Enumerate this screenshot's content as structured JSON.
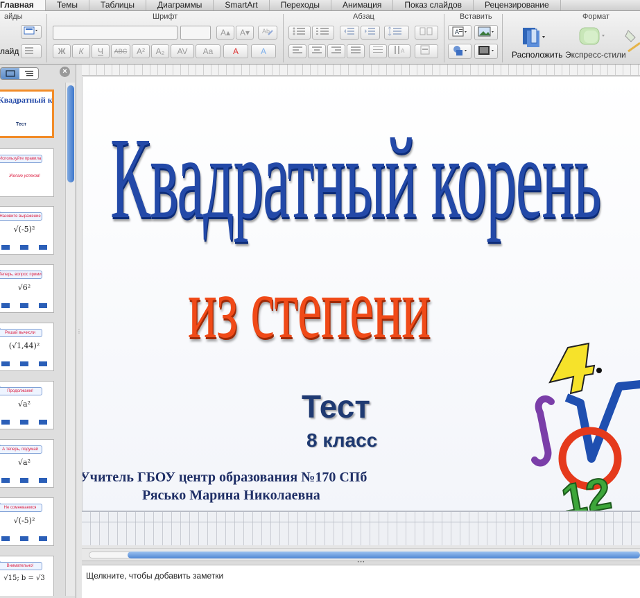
{
  "tabs": [
    "Главная",
    "Темы",
    "Таблицы",
    "Диаграммы",
    "SmartArt",
    "Переходы",
    "Анимация",
    "Показ слайдов",
    "Рецензирование"
  ],
  "ribbon": {
    "groups": {
      "slides": "айды",
      "font": "Шрифт",
      "paragraph": "Абзац",
      "insert": "Вставить",
      "format": "Формат"
    },
    "new_slide_label": "лайд",
    "arrange_label": "Расположить",
    "quick_styles_label": "Экспресс-стили",
    "font_buttons": [
      "Ж",
      "К",
      "Ч",
      "ABC",
      "A²",
      "A₂",
      "AV",
      "Aa",
      "A",
      "A"
    ],
    "size_buttons": [
      "A▴",
      "A▾"
    ]
  },
  "slide": {
    "title_line1": "Квадратный корень",
    "title_line2": "из степени",
    "subtitle": "Тест",
    "grade": "8 класс",
    "teacher_line1": "Учитель ГБОУ центр образования №170  СПб",
    "teacher_line2": "Рясько Марина Николаевна",
    "deco_digits": [
      "4",
      "12"
    ]
  },
  "thumbnails": [
    {
      "title": "Квадратный корень из степени",
      "body": "Тест"
    },
    {
      "title": "Используйте правила",
      "body": "Желаю успехов!"
    },
    {
      "title": "Назовите выражение",
      "body": "√(-5)²"
    },
    {
      "title": "Теперь, вопрос прими",
      "body": "√6²"
    },
    {
      "title": "Решай вычисли",
      "body": "(√1,44)²"
    },
    {
      "title": "Продолжаем!",
      "body": "√a²"
    },
    {
      "title": "А теперь, подумай",
      "body": "√a²"
    },
    {
      "title": "Не сомневаемся",
      "body": "√(-5)²"
    },
    {
      "title": "Внимательно!",
      "body": "√15; b = √3"
    }
  ],
  "notes_placeholder": "Щелкните, чтобы добавить заметки",
  "colors": {
    "title_blue": "#2349a8",
    "title_orange": "#f04a18",
    "text_navy": "#1f3a72",
    "selection_orange": "#f28c28"
  }
}
